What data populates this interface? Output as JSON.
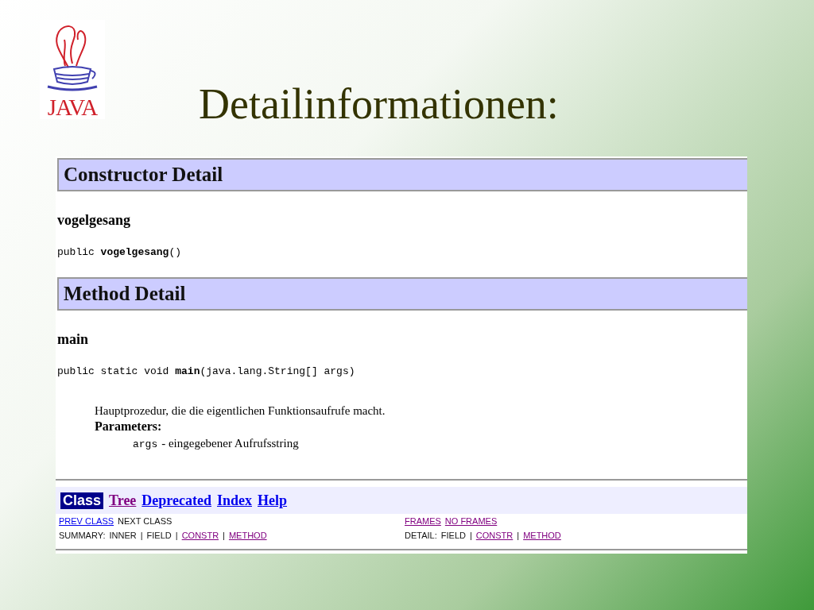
{
  "slide": {
    "title": "Detailinformationen:"
  },
  "logo": {
    "text": "JAVA"
  },
  "doc": {
    "sections": [
      {
        "heading": "Constructor Detail",
        "members": [
          {
            "name": "vogelgesang",
            "signature": "public **vogelgesang**()"
          }
        ]
      },
      {
        "heading": "Method Detail",
        "members": [
          {
            "name": "main",
            "signature": "public static void **main**(java.lang.String[] args)",
            "description": "Hauptprozedur, die die eigentlichen Funktionsaufrufe macht.",
            "params_label": "Parameters:",
            "params": [
              {
                "name": "args",
                "text": "- eingegebener Aufrufsstring"
              }
            ]
          }
        ]
      }
    ],
    "navbar": [
      {
        "label": "Class",
        "selected": true,
        "visited": false
      },
      {
        "label": "Tree",
        "selected": false,
        "visited": true
      },
      {
        "label": "Deprecated",
        "selected": false,
        "visited": false
      },
      {
        "label": "Index",
        "selected": false,
        "visited": false
      },
      {
        "label": "Help",
        "selected": false,
        "visited": false
      }
    ],
    "subnav": [
      {
        "left": [
          {
            "label": "PREV CLASS",
            "kind": "link",
            "visited": false
          },
          {
            "label": "NEXT CLASS",
            "kind": "text"
          }
        ],
        "right": [
          {
            "label": "FRAMES",
            "kind": "link",
            "visited": true
          },
          {
            "label": "NO FRAMES",
            "kind": "link",
            "visited": true
          }
        ]
      },
      {
        "left": [
          {
            "label": "SUMMARY:",
            "kind": "text"
          },
          {
            "label": "INNER",
            "kind": "text"
          },
          {
            "label": "|",
            "kind": "text"
          },
          {
            "label": "FIELD",
            "kind": "text"
          },
          {
            "label": "|",
            "kind": "text"
          },
          {
            "label": "CONSTR",
            "kind": "link",
            "visited": true
          },
          {
            "label": "|",
            "kind": "text"
          },
          {
            "label": "METHOD",
            "kind": "link",
            "visited": true
          }
        ],
        "right": [
          {
            "label": "DETAIL:",
            "kind": "text"
          },
          {
            "label": "FIELD",
            "kind": "text"
          },
          {
            "label": "|",
            "kind": "text"
          },
          {
            "label": "CONSTR",
            "kind": "link",
            "visited": true
          },
          {
            "label": "|",
            "kind": "text"
          },
          {
            "label": "METHOD",
            "kind": "link",
            "visited": true
          }
        ]
      }
    ]
  }
}
